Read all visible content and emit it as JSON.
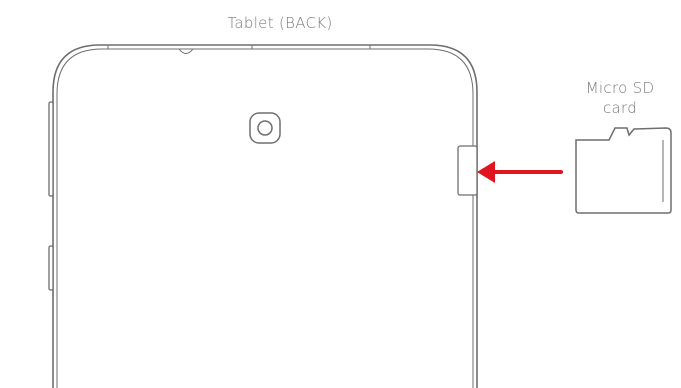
{
  "diagram": {
    "tablet_label": "Tablet (BACK)",
    "sd_card_label_line1": "Micro SD",
    "sd_card_label_line2": "card",
    "colors": {
      "outline": "#6e6e6e",
      "label": "#7a7a7a",
      "arrow": "#e0151f",
      "background": "#ffffff"
    },
    "icons": [
      "camera-lens-icon",
      "micro-sd-card-icon",
      "insert-arrow-icon"
    ]
  }
}
